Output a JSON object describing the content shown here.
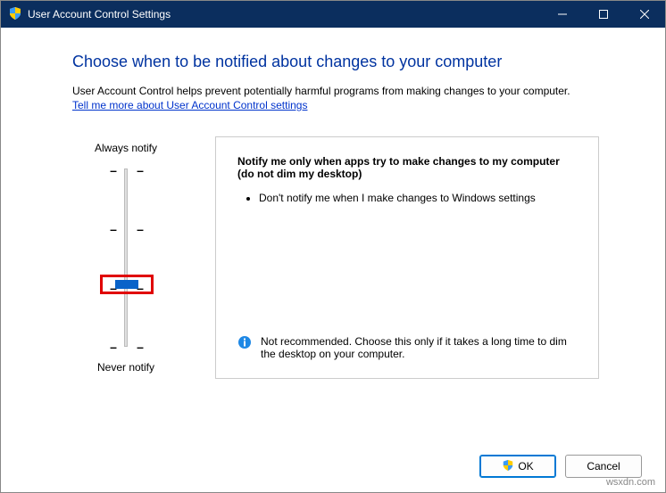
{
  "window": {
    "title": "User Account Control Settings"
  },
  "content": {
    "heading": "Choose when to be notified about changes to your computer",
    "description": "User Account Control helps prevent potentially harmful programs from making changes to your computer.",
    "link": "Tell me more about User Account Control settings"
  },
  "slider": {
    "top_label": "Always notify",
    "bottom_label": "Never notify",
    "levels": 4,
    "current_level": 1
  },
  "panel": {
    "title": "Notify me only when apps try to make changes to my computer (do not dim my desktop)",
    "bullets": [
      "Don't notify me when I make changes to Windows settings"
    ],
    "warning": "Not recommended. Choose this only if it takes a long time to dim the desktop on your computer."
  },
  "buttons": {
    "ok": "OK",
    "cancel": "Cancel"
  },
  "watermark": "wsxdn.com"
}
